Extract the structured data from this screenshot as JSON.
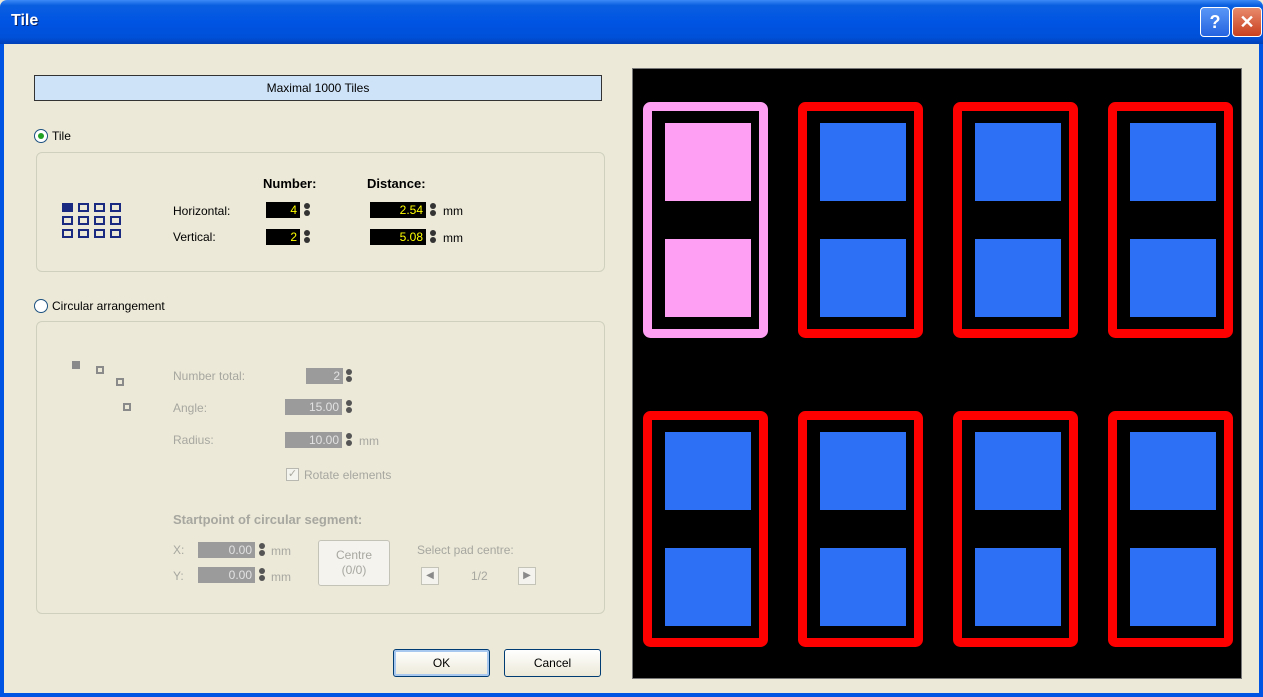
{
  "window": {
    "title": "Tile",
    "help_label": "?",
    "close_label": "✕"
  },
  "banner": "Maximal 1000 Tiles",
  "tile_section": {
    "radio_label": "Tile",
    "selected": true,
    "header_number": "Number:",
    "header_distance": "Distance:",
    "horizontal_label": "Horizontal:",
    "vertical_label": "Vertical:",
    "horizontal_number": "4",
    "vertical_number": "2",
    "horizontal_distance": "2.54",
    "vertical_distance": "5.08",
    "unit": "mm"
  },
  "circular_section": {
    "radio_label": "Circular arrangement",
    "selected": false,
    "number_total_label": "Number total:",
    "number_total": "2",
    "angle_label": "Angle:",
    "angle": "15.00",
    "radius_label": "Radius:",
    "radius": "10.00",
    "unit": "mm",
    "rotate_label": "Rotate elements",
    "rotate_checked": true,
    "startpoint_header": "Startpoint of circular segment:",
    "x_label": "X:",
    "y_label": "Y:",
    "x_value": "0.00",
    "y_value": "0.00",
    "centre_line1": "Centre",
    "centre_line2": "(0/0)",
    "select_pad_label": "Select pad centre:",
    "pad_page": "1/2"
  },
  "buttons": {
    "ok": "OK",
    "cancel": "Cancel"
  },
  "preview": {
    "rows": 2,
    "cols": 4,
    "selected_color": "#ff9ff3",
    "outline_color": "#ff0000",
    "pad_color": "#2d6ff5",
    "background": "#000000"
  }
}
